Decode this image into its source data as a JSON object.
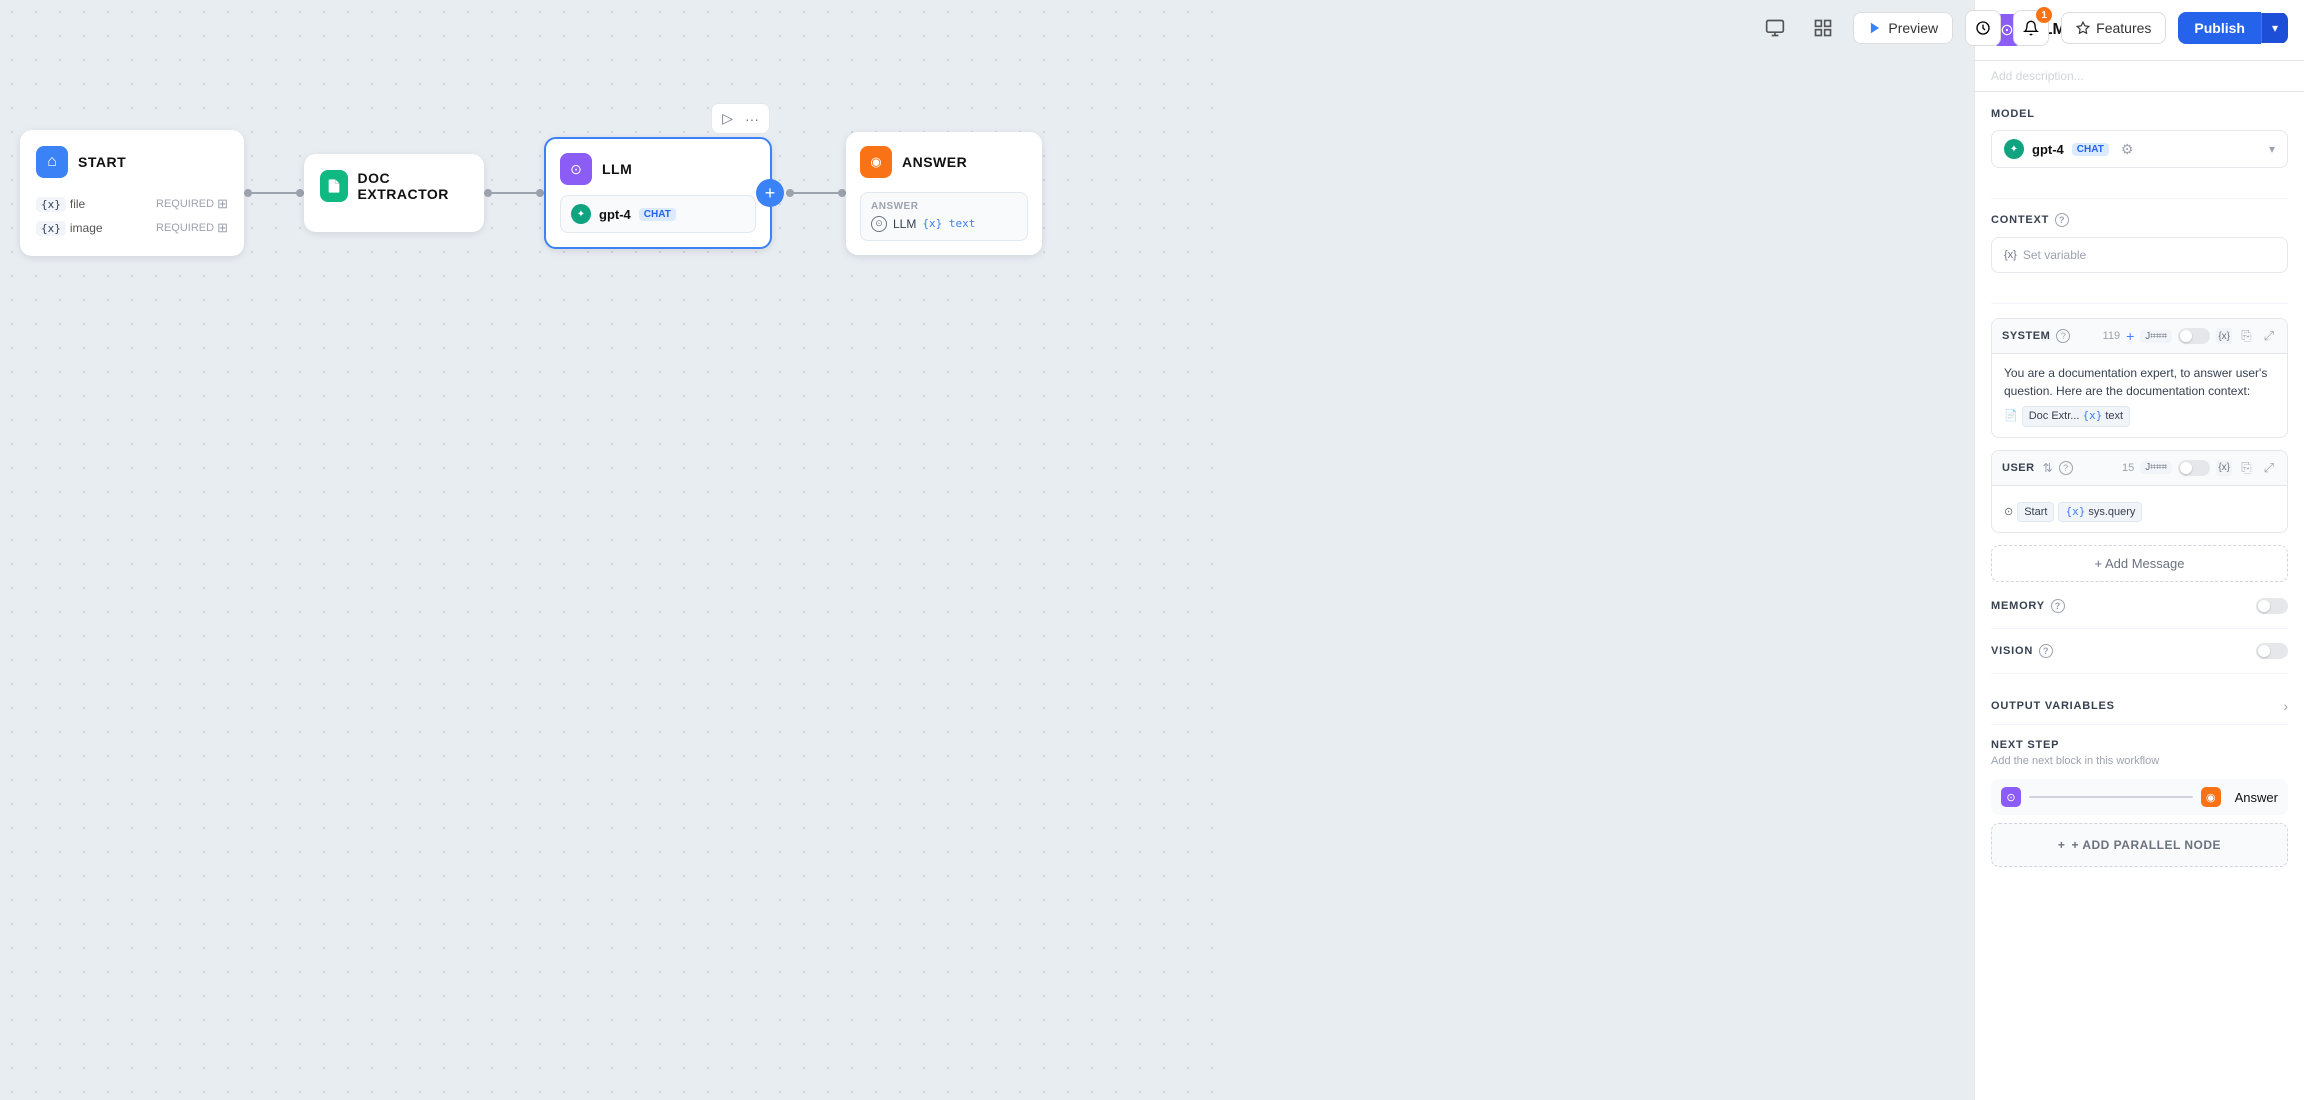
{
  "topbar": {
    "preview_label": "Preview",
    "features_label": "Features",
    "publish_label": "Publish",
    "notification_count": "1"
  },
  "canvas": {
    "nodes": [
      {
        "id": "start",
        "title": "START",
        "icon_type": "blue",
        "icon_glyph": "⌂",
        "fields": [
          {
            "name": "file",
            "required": true
          },
          {
            "name": "image",
            "required": true
          }
        ]
      },
      {
        "id": "doc_extractor",
        "title": "DOC EXTRACTOR",
        "icon_type": "green",
        "icon_glyph": "📄"
      },
      {
        "id": "llm",
        "title": "LLM",
        "icon_type": "purple",
        "icon_glyph": "⊙",
        "model": "gpt-4",
        "model_badge": "CHAT",
        "selected": true
      },
      {
        "id": "answer",
        "title": "ANSWER",
        "icon_type": "orange",
        "icon_glyph": "◉",
        "answer_label": "ANSWER",
        "answer_from": "LLM",
        "answer_var": "text"
      }
    ]
  },
  "panel": {
    "title": "LLM",
    "description_placeholder": "Add description...",
    "model_section": "MODEL",
    "model_name": "gpt-4",
    "model_badge": "CHAT",
    "context_section": "CONTEXT",
    "context_placeholder": "Set variable",
    "system_section": "SYSTEM",
    "system_count": "119",
    "system_text": "You are a documentation expert, to answer user's question. Here are the documentation context:",
    "system_ref_label": "Doc Extr...",
    "system_ref_var": "text",
    "user_section": "USER",
    "user_count": "15",
    "user_ref_label": "Start",
    "user_ref_var": "sys.query",
    "add_message_label": "+ Add Message",
    "memory_section": "MEMORY",
    "vision_section": "VISION",
    "output_variables_section": "OUTPUT VARIABLES",
    "next_step_section": "NEXT STEP",
    "next_step_desc": "Add the next block in this workflow",
    "next_step_node": "Answer",
    "add_parallel_label": "+ ADD PARALLEL NODE"
  }
}
